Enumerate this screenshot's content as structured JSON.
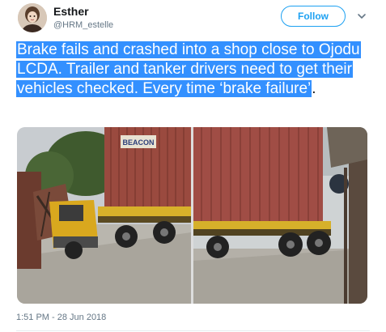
{
  "user": {
    "display_name": "Esther",
    "handle": "@HRM_estelle"
  },
  "follow_button": {
    "label": "Follow"
  },
  "tweet": {
    "text": "Brake fails and crashed into a shop close to Ojodu LCDA. Trailer and tanker drivers need to get their vehicles checked. Every time ‘brake failure’",
    "text_tail": ".",
    "selection_color": "#3390ff",
    "timestamp": "1:51 PM - 28 Jun 2018"
  },
  "media": {
    "left_photo": {
      "description_icon": "photo-truck-crash",
      "container_label": "BEACON"
    },
    "right_photo": {
      "description_icon": "photo-truck-side"
    }
  },
  "colors": {
    "accent": "#1da1f2",
    "muted": "#657786",
    "text": "#14171a"
  }
}
